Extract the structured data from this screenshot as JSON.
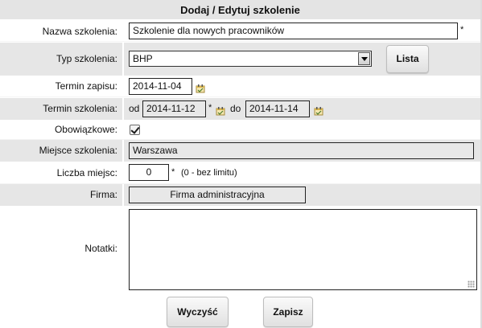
{
  "form": {
    "title": "Dodaj / Edytuj szkolenie",
    "fields": {
      "nazwa": {
        "label": "Nazwa szkolenia:",
        "value": "Szkolenie dla nowych pracowników",
        "required_mark": "*"
      },
      "typ": {
        "label": "Typ szkolenia:",
        "selected": "BHP",
        "button_label": "Lista"
      },
      "termin_zapisu": {
        "label": "Termin zapisu:",
        "value": "2014-11-04"
      },
      "termin_szkolenia": {
        "label": "Termin szkolenia:",
        "from_label": "od",
        "from_value": "2014-11-12",
        "required_mark": "*",
        "to_label": "do",
        "to_value": "2014-11-14"
      },
      "obowiazkowe": {
        "label": "Obowiązkowe:",
        "checked": true
      },
      "miejsce": {
        "label": "Miejsce szkolenia:",
        "value": "Warszawa"
      },
      "liczba_miejsc": {
        "label": "Liczba miejsc:",
        "value": "0",
        "required_mark": "*",
        "hint": "(0 - bez limitu)"
      },
      "firma": {
        "label": "Firma:",
        "value": "Firma administracyjna"
      },
      "notatki": {
        "label": "Notatki:",
        "value": ""
      }
    },
    "buttons": {
      "clear_label": "Wyczyść",
      "save_label": "Zapisz"
    }
  },
  "icons": {
    "calendar": "calendar-icon",
    "resize_grip": "resize-grip-icon",
    "dropdown_arrow": "chevron-down-icon"
  },
  "colors": {
    "shaded_row": "#e6e6e6",
    "title_bar": "#e4e4e4",
    "readonly_input": "#e8e8e8"
  }
}
